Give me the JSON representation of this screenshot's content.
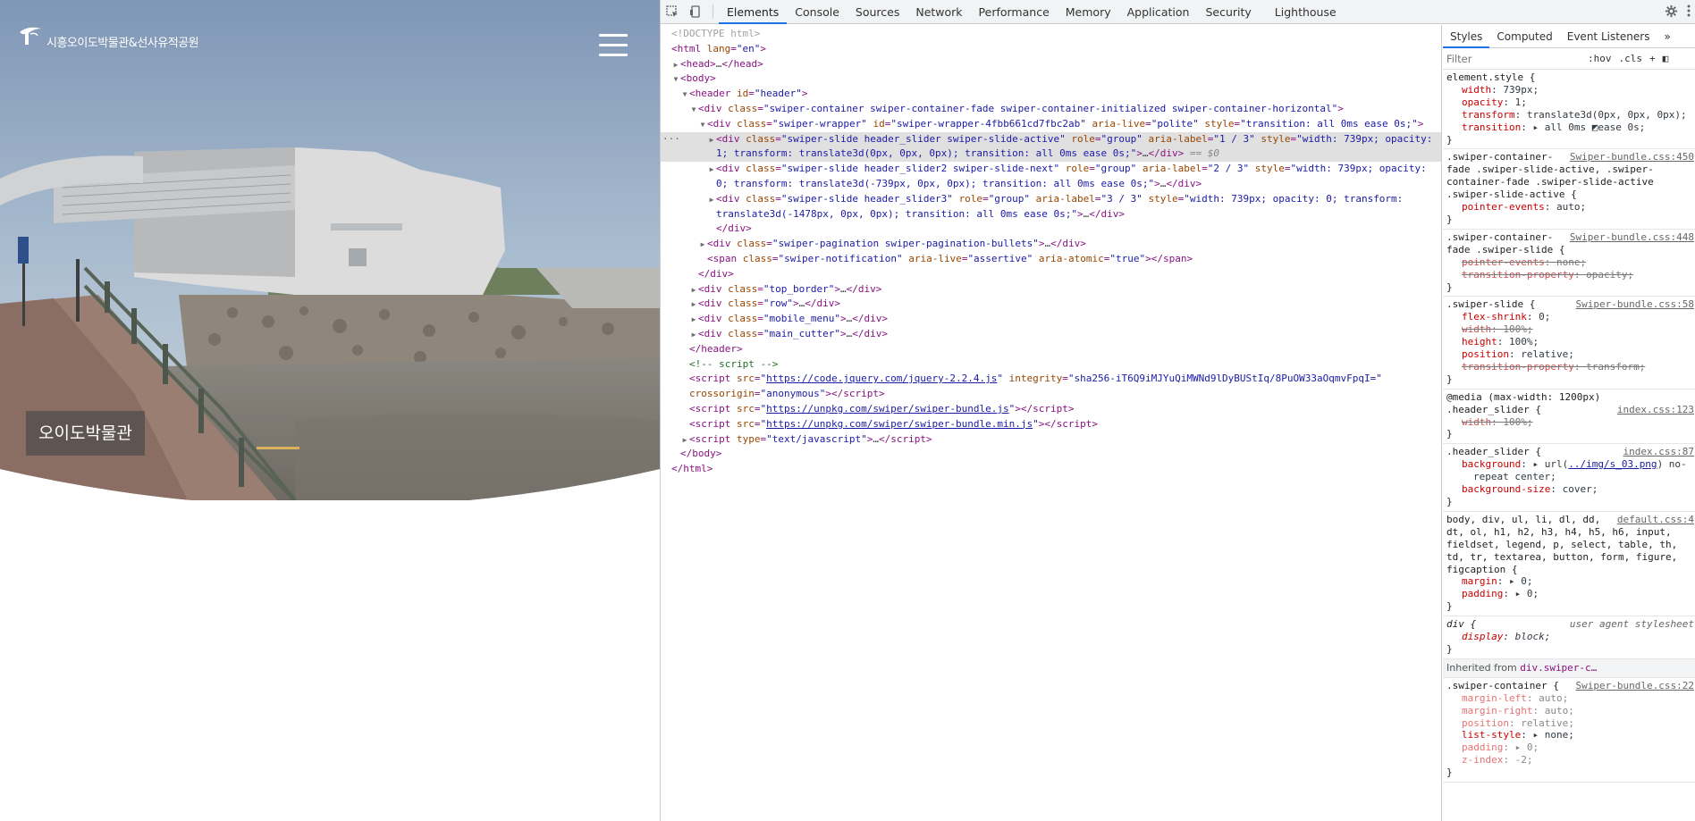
{
  "site": {
    "logo_text": "시흥오이도박물관&선사유적공원",
    "caption": "오이도박물관",
    "accent": "#d9b25a"
  },
  "devtools": {
    "tabs": [
      "Elements",
      "Console",
      "Sources",
      "Network",
      "Performance",
      "Memory",
      "Application",
      "Security",
      "Lighthouse"
    ],
    "active_tab": "Elements",
    "icons": {
      "inspect": "inspect-icon",
      "device": "device-toolbar-icon",
      "settings": "gear-icon",
      "more": "kebab-menu-icon"
    },
    "tree": [
      {
        "kind": "doctype",
        "indent": 0,
        "text": "<!DOCTYPE html>"
      },
      {
        "kind": "tag",
        "indent": 0,
        "tri": "",
        "html": "&lt;html lang=\"en\"&gt;"
      },
      {
        "kind": "tag",
        "indent": 1,
        "tri": "right",
        "html": "&lt;head&gt;…&lt;/head&gt;"
      },
      {
        "kind": "tag",
        "indent": 1,
        "tri": "down",
        "html": "&lt;body&gt;"
      },
      {
        "kind": "tag",
        "indent": 2,
        "tri": "down",
        "html": "&lt;header id=\"header\"&gt;"
      },
      {
        "kind": "tag",
        "indent": 3,
        "tri": "down",
        "html": "&lt;div class=\"swiper-container swiper-container-fade swiper-container-initialized swiper-container-horizontal\"&gt;"
      },
      {
        "kind": "tag",
        "indent": 4,
        "tri": "down",
        "html": "&lt;div class=\"swiper-wrapper\" id=\"swiper-wrapper-4fbb661cd7fbc2ab\" aria-live=\"polite\" style=\"transition: all 0ms ease 0s;\"&gt;"
      }
    ],
    "styles": {
      "tabs": [
        "Styles",
        "Computed",
        "Event Listeners"
      ],
      "filter_placeholder": "Filter",
      "hov": ":hov",
      "cls": ".cls",
      "inherited_label": "Inherited from",
      "inherited_from": "div.swiper-c…"
    }
  }
}
